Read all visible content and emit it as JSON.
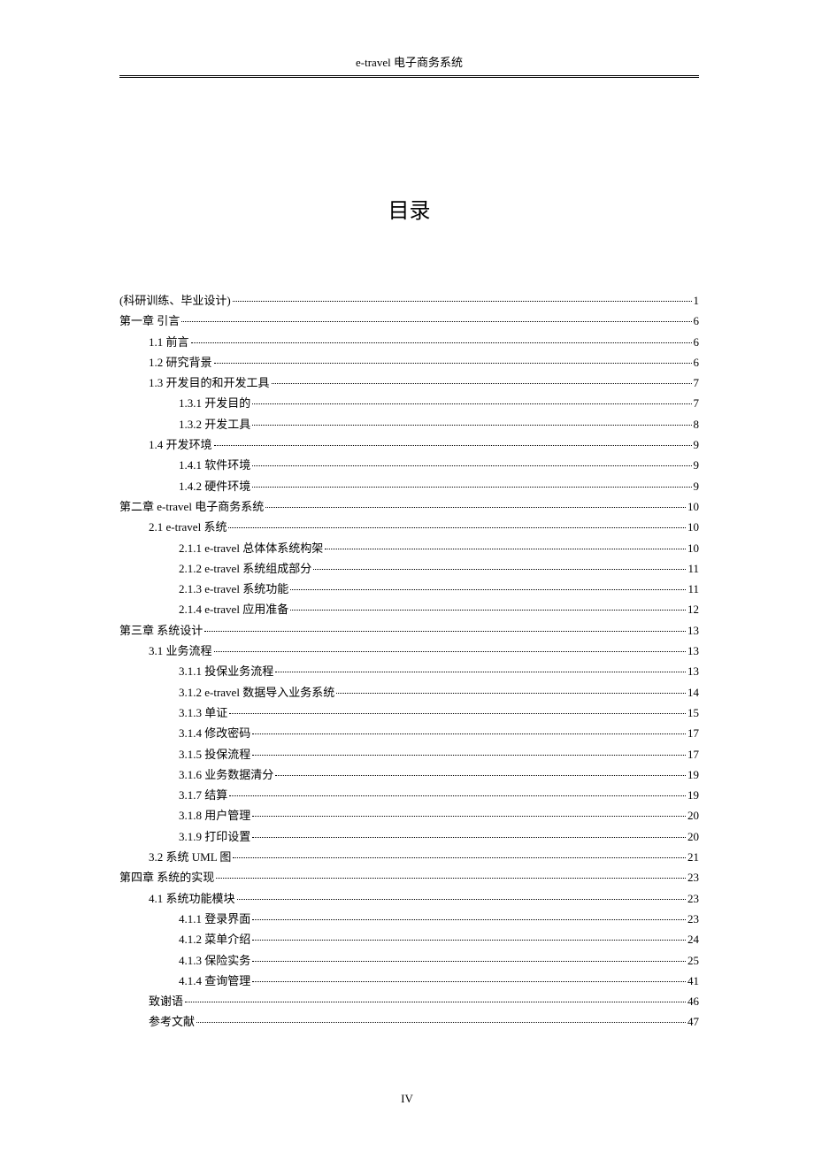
{
  "header": "e-travel 电子商务系统",
  "title": "目录",
  "pageNumber": "IV",
  "toc": [
    {
      "indent": 0,
      "label": "(科研训练、毕业设计)",
      "page": "1"
    },
    {
      "indent": 0,
      "label": "第一章  引言",
      "page": "6"
    },
    {
      "indent": 1,
      "label": "1.1  前言",
      "page": "6"
    },
    {
      "indent": 1,
      "label": "1.2  研究背景",
      "page": "6"
    },
    {
      "indent": 1,
      "label": "1.3  开发目的和开发工具",
      "page": "7"
    },
    {
      "indent": 2,
      "label": "1.3.1  开发目的",
      "page": "7"
    },
    {
      "indent": 2,
      "label": "1.3.2  开发工具",
      "page": "8"
    },
    {
      "indent": 1,
      "label": "1.4  开发环境",
      "page": "9"
    },
    {
      "indent": 2,
      "label": "1.4.1  软件环境",
      "page": "9"
    },
    {
      "indent": 2,
      "label": "1.4.2 硬件环境",
      "page": "9"
    },
    {
      "indent": 0,
      "label": "第二章  e-travel 电子商务系统 ",
      "page": "10"
    },
    {
      "indent": 1,
      "label": "2.1 e-travel 系统 ",
      "page": "10"
    },
    {
      "indent": 2,
      "label": "2.1.1 e-travel 总体体系统构架 ",
      "page": "10"
    },
    {
      "indent": 2,
      "label": "2.1.2 e-travel 系统组成部分 ",
      "page": "11"
    },
    {
      "indent": 2,
      "label": "2.1.3 e-travel 系统功能 ",
      "page": "11"
    },
    {
      "indent": 2,
      "label": "2.1.4  e-travel 应用准备",
      "page": "12"
    },
    {
      "indent": 0,
      "label": "第三章  系统设计",
      "page": "13"
    },
    {
      "indent": 1,
      "label": "3.1  业务流程",
      "page": "13"
    },
    {
      "indent": 2,
      "label": "3.1.1  投保业务流程",
      "page": "13"
    },
    {
      "indent": 2,
      "label": "3.1.2  e-travel  数据导入业务系统 ",
      "page": "14"
    },
    {
      "indent": 2,
      "label": "3.1.3  单证",
      "page": "15"
    },
    {
      "indent": 2,
      "label": "3.1.4  修改密码",
      "page": "17"
    },
    {
      "indent": 2,
      "label": "3.1.5  投保流程",
      "page": "17"
    },
    {
      "indent": 2,
      "label": "3.1.6  业务数据清分",
      "page": "19"
    },
    {
      "indent": 2,
      "label": "3.1.7  结算",
      "page": "19"
    },
    {
      "indent": 2,
      "label": "3.1.8 用户管理",
      "page": "20"
    },
    {
      "indent": 2,
      "label": "3.1.9    打印设置",
      "page": "20"
    },
    {
      "indent": 1,
      "label": "3.2  系统 UML 图",
      "page": "21"
    },
    {
      "indent": 0,
      "label": "第四章  系统的实现",
      "page": "23"
    },
    {
      "indent": 1,
      "label": "4.1  系统功能模块",
      "page": "23"
    },
    {
      "indent": 2,
      "label": "4.1.1 登录界面",
      "page": "23"
    },
    {
      "indent": 2,
      "label": "4.1.2 菜单介绍",
      "page": "24"
    },
    {
      "indent": 2,
      "label": "4.1.3 保险实务",
      "page": "25"
    },
    {
      "indent": 2,
      "label": "4.1.4 查询管理",
      "page": "41"
    },
    {
      "indent": 1,
      "label": "致谢语",
      "page": "46"
    },
    {
      "indent": 1,
      "label": "参考文献",
      "page": "47"
    }
  ]
}
